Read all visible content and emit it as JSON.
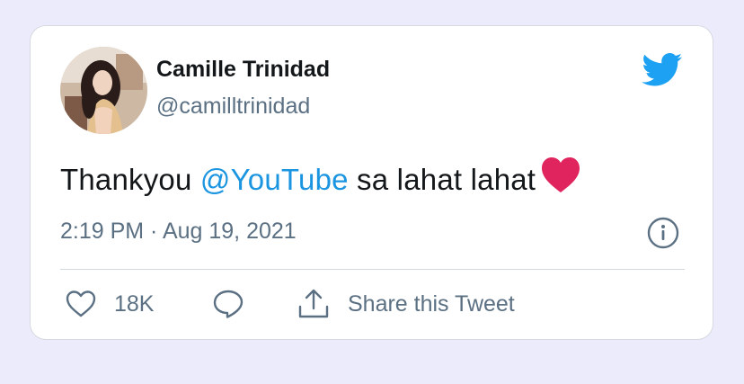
{
  "author": {
    "name": "Camille Trinidad",
    "handle": "@camilltrinidad"
  },
  "tweet": {
    "text_before": "Thankyou ",
    "mention": "@YouTube",
    "text_after": " sa lahat lahat",
    "emoji": "red-heart",
    "timestamp": "2:19 PM · Aug 19, 2021"
  },
  "actions": {
    "like_count": "18K",
    "share_label": "Share this Tweet"
  },
  "icons": {
    "brand": "twitter-bird-icon",
    "info": "info-icon",
    "like": "heart-outline-icon",
    "reply": "speech-bubble-icon",
    "share": "share-upload-icon"
  },
  "colors": {
    "background": "#ebebfc",
    "card": "#ffffff",
    "twitter_blue": "#1da1f2",
    "mention": "#1b95e0",
    "text_primary": "#14171a",
    "text_secondary": "#5b7083",
    "heart_red": "#e0245e"
  }
}
